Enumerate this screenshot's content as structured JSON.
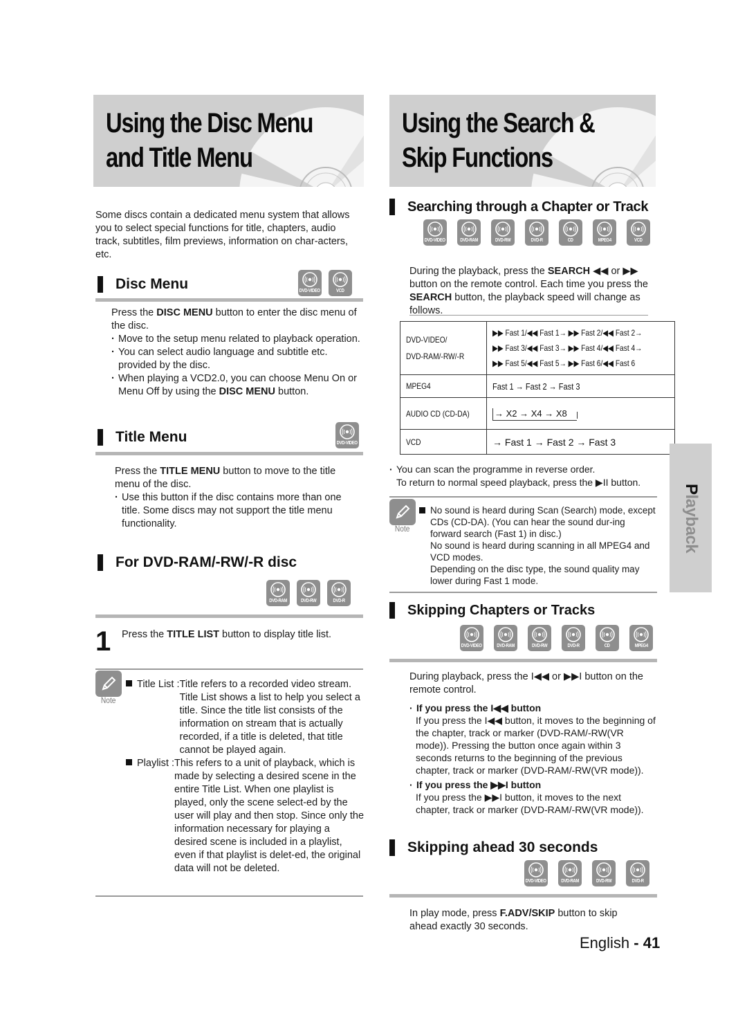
{
  "left": {
    "banner_title_line1": "Using the Disc Menu",
    "banner_title_line2": "and Title Menu",
    "intro": "Some discs contain a dedicated menu system that allows you to select special functions for title, chapters, audio track, subtitles, film previews, information on char-acters, etc.",
    "disc_menu": {
      "heading": "Disc Menu",
      "icons": [
        "DVD-VIDEO",
        "VCD"
      ],
      "para_pre": "Press the ",
      "para_bold": "DISC MENU",
      "para_post": " button to enter the disc menu of the disc.",
      "bullet1": "Move to the setup menu related to playback operation.",
      "bullet2": "You can select audio language and subtitle etc. provided by the disc.",
      "bullet3_pre": "When playing a VCD2.0, you can choose Menu On or Menu Off by using the ",
      "bullet3_bold": "DISC MENU",
      "bullet3_post": " button."
    },
    "title_menu": {
      "heading": "Title Menu",
      "icons": [
        "DVD-VIDEO"
      ],
      "para_pre": "Press the ",
      "para_bold": "TITLE MENU",
      "para_post": " button to move to the title menu of the disc.",
      "bullet1": "Use this button if the disc contains more than one title. Some discs may not support the title menu functionality."
    },
    "dvd_ram": {
      "heading": "For DVD-RAM/-RW/-R disc",
      "icons": [
        "DVD-RAM",
        "DVD-RW",
        "DVD-R"
      ],
      "step_number": "1",
      "step_pre": "Press the ",
      "step_bold": "TITLE LIST",
      "step_post": " button to display title list."
    },
    "note": {
      "label": "Note",
      "item1_term": "Title List : ",
      "item1_text": "Title refers to a recorded video stream. Title List shows a list to help you select a title. Since the title list consists of the information on stream that is actually recorded, if a title is deleted, that title cannot be played again.",
      "item2_term": "Playlist : ",
      "item2_text": "This refers to a unit of playback, which is made by selecting a desired scene in the entire Title List. When one playlist is played, only the scene select-ed by the user will play and then stop. Since only the information necessary for playing a desired scene is included in a playlist, even if that playlist is delet-ed, the original data will not be deleted."
    }
  },
  "right": {
    "banner_title_line1": "Using the Search &",
    "banner_title_line2": "Skip Functions",
    "search": {
      "heading": "Searching through a Chapter or Track",
      "icons": [
        "DVD-VIDEO",
        "DVD-RAM",
        "DVD-RW",
        "DVD-R",
        "CD",
        "MPEG4",
        "VCD"
      ],
      "para_pre": "During the playback, press the ",
      "para_bold1": "SEARCH",
      "para_mid1": " ◀◀ or ▶▶ button on the remote control. Each time you press the ",
      "para_bold2": "SEARCH",
      "para_post": " button, the playback speed will change as follows.",
      "table": [
        {
          "disc_line1": "DVD-VIDEO/",
          "disc_line2": "DVD-RAM/-RW/-R",
          "speeds": [
            "▶▶ Fast 1/◀◀ Fast 1→ ▶▶ Fast 2/◀◀ Fast 2→",
            "▶▶ Fast 3/◀◀ Fast 3→ ▶▶ Fast 4/◀◀ Fast 4→",
            "▶▶ Fast 5/◀◀ Fast 5→ ▶▶ Fast 6/◀◀ Fast 6"
          ]
        },
        {
          "disc_line1": "MPEG4",
          "speeds": [
            "Fast 1 → Fast 2 → Fast 3"
          ]
        },
        {
          "disc_line1": "AUDIO CD (CD-DA)",
          "speeds": [
            "→ X2 → X4 → X8"
          ]
        },
        {
          "disc_line1": "VCD",
          "speeds": [
            "→ Fast 1 → Fast 2 → Fast 3"
          ]
        }
      ],
      "bullet1": "You can scan the programme in reverse order.",
      "bullet1_line2": "To return to normal speed playback, press the ▶II button."
    },
    "note": {
      "label": "Note",
      "line1": "No sound is heard during Scan (Search) mode, except CDs (CD-DA). (You can hear the sound dur-ing forward search (Fast 1) in disc.)",
      "line2": "No sound is heard during scanning in all MPEG4 and VCD modes.",
      "line3": "Depending on the disc type, the sound quality may lower during  Fast 1 mode."
    },
    "skip": {
      "heading": "Skipping Chapters or Tracks",
      "icons": [
        "DVD-VIDEO",
        "DVD-RAM",
        "DVD-RW",
        "DVD-R",
        "CD",
        "MPEG4"
      ],
      "para": "During playback, press the I◀◀ or ▶▶I button on the remote control.",
      "sub1_title": "If you press the I◀◀ button",
      "sub1_text": "If you press the I◀◀ button, it moves to the beginning of the chapter, track or marker (DVD-RAM/-RW(VR mode)). Pressing the button once again within 3 seconds returns to the beginning of the previous chapter, track or marker (DVD-RAM/-RW(VR mode)).",
      "sub2_title": "If you press the ▶▶I button",
      "sub2_text": "If you press the ▶▶I button, it moves to the next chapter, track or marker (DVD-RAM/-RW(VR mode))."
    },
    "skip30": {
      "heading": "Skipping ahead 30 seconds",
      "icons": [
        "DVD-VIDEO",
        "DVD-RAM",
        "DVD-RW",
        "DVD-R"
      ],
      "para_pre": "In play mode, press ",
      "para_bold": "F.ADV/SKIP",
      "para_post": " button to skip ahead exactly 30 seconds."
    }
  },
  "side_tab": "Playback",
  "footer": {
    "language": "English",
    "separator": " - ",
    "page": "41"
  }
}
